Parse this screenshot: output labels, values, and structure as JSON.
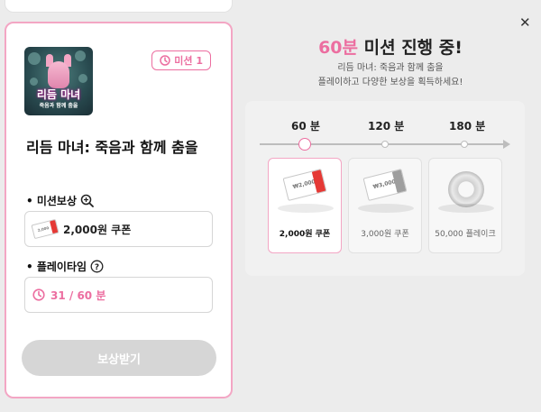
{
  "mission_card": {
    "thumbnail": {
      "logo_line1": "리듬 마녀",
      "logo_line2": "죽음과 함께 춤을"
    },
    "badge": {
      "icon": "clock-icon",
      "label": "미션 1"
    },
    "game_title": "리듬 마녀: 죽음과 함께 춤을",
    "reward_section": {
      "label": "• 미션보상",
      "icon": "zoom-in-icon",
      "value": "2,000원 쿠폰",
      "coupon_amount": "2,000"
    },
    "playtime_section": {
      "label": "• 플레이타임",
      "icon": "help-icon",
      "value": "31 / 60 분",
      "value_icon": "clock-icon"
    },
    "claim_button": "보상받기"
  },
  "mission_panel": {
    "close_icon": "close-icon",
    "heading_highlight": "60분",
    "heading_rest": " 미션 진행 중!",
    "desc_line1": "리듬 마녀: 죽음과 함께 춤을",
    "desc_line2": "플레이하고 다양한 보상을 획득하세요!",
    "timeline": [
      {
        "label": "60 분",
        "active": true
      },
      {
        "label": "120 분",
        "active": false
      },
      {
        "label": "180 분",
        "active": false
      }
    ],
    "rewards": [
      {
        "label": "2,000원 쿠폰",
        "amount": "₩2,000",
        "type": "coupon",
        "stub_color": "#e53935",
        "active": true
      },
      {
        "label": "3,000원 쿠폰",
        "amount": "₩3,000",
        "type": "coupon",
        "stub_color": "#9e9e9e",
        "active": false
      },
      {
        "label": "50,000 플레이크",
        "type": "flake",
        "active": false
      }
    ]
  },
  "colors": {
    "accent_pink": "#ec6ea0",
    "card_border": "#f3a6c4",
    "button_disabled": "#d6d6d6"
  }
}
